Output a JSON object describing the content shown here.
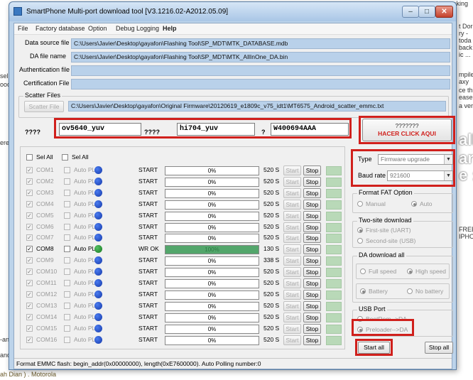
{
  "background": {
    "top_right_text": "making",
    "right_snippets": [
      "t Dor",
      "ry -",
      "toda",
      "back f",
      "ic ...",
      "mpile",
      "axy",
      "ce th",
      "ease",
      "a very",
      "all",
      "ar",
      "e :",
      "FREE",
      "IPHO"
    ],
    "left_snippets": [
      "sel",
      "ooce",
      "ere",
      "-and",
      "and"
    ],
    "bottom_text": "ah Dian ) . Motorola"
  },
  "window": {
    "title": "SmartPhone Multi-port download tool [V3.1216.02-A2012.05.09]",
    "buttons": {
      "minimize": "–",
      "maximize": "□",
      "close": "✕"
    }
  },
  "menu": [
    "File",
    "Factory database",
    "Option",
    "Debug Logging",
    "Help"
  ],
  "files": {
    "data_source": {
      "label": "Data source file",
      "value": "C:\\Users\\Javier\\Desktop\\gayafon\\Flashing Tool\\SP_MDT\\MTK_DATABASE.mdb"
    },
    "da_file": {
      "label": "DA file name",
      "value": "C:\\Users\\Javier\\Desktop\\gayafon\\Flashing Tool\\SP_MDT\\MTK_AllInOne_DA.bin"
    },
    "auth_file": {
      "label": "Authentication file",
      "value": ""
    },
    "cert_file": {
      "label": "Certification File",
      "value": ""
    }
  },
  "scatter": {
    "group_title": "Scatter Files",
    "button": "Scatter File",
    "value": "C:\\Users\\Javier\\Desktop\\gayafon\\Original Firmware\\20120619_e1809c_v75_idt1\\MT6575_Android_scatter_emmc.txt"
  },
  "chips": {
    "label1": "????",
    "value1": "ov5640_yuv",
    "label2": "????",
    "value2": "hi704_yuv",
    "label3": "?",
    "value3": "W400694AAA"
  },
  "hacer_button": {
    "line1": "???????",
    "line2": "HACER CLICK AQUI"
  },
  "sel_all": [
    "Sel All",
    "Sel All"
  ],
  "ports": [
    {
      "com": "COM1",
      "autopl": "Auto PL",
      "status": "START",
      "progress": 0,
      "progress_text": "0%",
      "size": "520 S",
      "active": false
    },
    {
      "com": "COM2",
      "autopl": "Auto PL",
      "status": "START",
      "progress": 0,
      "progress_text": "0%",
      "size": "520 S",
      "active": false
    },
    {
      "com": "COM3",
      "autopl": "Auto PL",
      "status": "START",
      "progress": 0,
      "progress_text": "0%",
      "size": "520 S",
      "active": false
    },
    {
      "com": "COM4",
      "autopl": "Auto PL",
      "status": "START",
      "progress": 0,
      "progress_text": "0%",
      "size": "520 S",
      "active": false
    },
    {
      "com": "COM5",
      "autopl": "Auto PL",
      "status": "START",
      "progress": 0,
      "progress_text": "0%",
      "size": "520 S",
      "active": false
    },
    {
      "com": "COM6",
      "autopl": "Auto PL",
      "status": "START",
      "progress": 0,
      "progress_text": "0%",
      "size": "520 S",
      "active": false
    },
    {
      "com": "COM7",
      "autopl": "Auto PL",
      "status": "START",
      "progress": 0,
      "progress_text": "0%",
      "size": "520 S",
      "active": false
    },
    {
      "com": "COM8",
      "autopl": "Auto PL",
      "status": "WR OK",
      "progress": 100,
      "progress_text": "100%",
      "size": "130 S",
      "active": true
    },
    {
      "com": "COM9",
      "autopl": "Auto PL",
      "status": "START",
      "progress": 0,
      "progress_text": "0%",
      "size": "338 S",
      "active": false
    },
    {
      "com": "COM10",
      "autopl": "Auto PL",
      "status": "START",
      "progress": 0,
      "progress_text": "0%",
      "size": "520 S",
      "active": false
    },
    {
      "com": "COM11",
      "autopl": "Auto PL",
      "status": "START",
      "progress": 0,
      "progress_text": "0%",
      "size": "520 S",
      "active": false
    },
    {
      "com": "COM12",
      "autopl": "Auto PL",
      "status": "START",
      "progress": 0,
      "progress_text": "0%",
      "size": "520 S",
      "active": false
    },
    {
      "com": "COM13",
      "autopl": "Auto PL",
      "status": "START",
      "progress": 0,
      "progress_text": "0%",
      "size": "520 S",
      "active": false
    },
    {
      "com": "COM14",
      "autopl": "Auto PL",
      "status": "START",
      "progress": 0,
      "progress_text": "0%",
      "size": "520 S",
      "active": false
    },
    {
      "com": "COM15",
      "autopl": "Auto PL",
      "status": "START",
      "progress": 0,
      "progress_text": "0%",
      "size": "520 S",
      "active": false
    },
    {
      "com": "COM16",
      "autopl": "Auto PL",
      "status": "START",
      "progress": 0,
      "progress_text": "0%",
      "size": "520 S",
      "active": false
    }
  ],
  "port_buttons": {
    "start": "Start",
    "stop": "Stop"
  },
  "type": {
    "label": "Type",
    "value": "Firmware upgrade"
  },
  "baud": {
    "label": "Baud rate",
    "value": "921600"
  },
  "format_fat": {
    "title": "Format FAT Option",
    "manual": "Manual",
    "auto": "Auto"
  },
  "two_site": {
    "title": "Two-site download",
    "first": "First-site (UART)",
    "second": "Second-site (USB)"
  },
  "da_download": {
    "title": "DA download all",
    "full_speed": "Full speed",
    "high_speed": "High speed",
    "battery": "Battery",
    "no_battery": "No battery"
  },
  "usb_port": {
    "title": "USB Port",
    "bootrom": "BootRom-->DA",
    "preloader": "Preloader-->DA"
  },
  "actions": {
    "start_all": "Start all",
    "stop_all": "Stop all"
  },
  "status_bar": "Format EMMC flash:  begin_addr(0x00000000), length(0xE7600000). Auto Polling number:0",
  "colors": {
    "highlight_red": "#d0201c",
    "progress_green": "#53a66b",
    "path_blue": "#b9d1ea"
  }
}
